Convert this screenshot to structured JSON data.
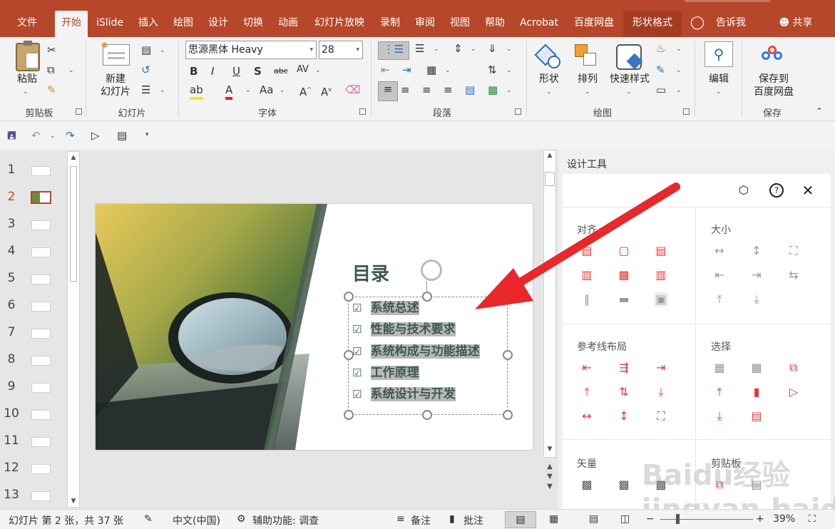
{
  "ribbon_tabs": [
    {
      "label": "文件",
      "active": false
    },
    {
      "label": "开始",
      "active": true
    },
    {
      "label": "iSlide",
      "active": false
    },
    {
      "label": "插入",
      "active": false
    },
    {
      "label": "绘图",
      "active": false
    },
    {
      "label": "设计",
      "active": false
    },
    {
      "label": "切换",
      "active": false
    },
    {
      "label": "动画",
      "active": false
    },
    {
      "label": "幻灯片放映",
      "active": false
    },
    {
      "label": "录制",
      "active": false
    },
    {
      "label": "审阅",
      "active": false
    },
    {
      "label": "视图",
      "active": false
    },
    {
      "label": "帮助",
      "active": false
    },
    {
      "label": "Acrobat",
      "active": false
    },
    {
      "label": "百度网盘",
      "active": false
    },
    {
      "label": "形状格式",
      "active": false
    }
  ],
  "tell_me": "告诉我",
  "share": "共享",
  "ribbon": {
    "paste": "粘贴",
    "clipboard": "剪贴板",
    "new_slide_line1": "新建",
    "new_slide_line2": "幻灯片",
    "slides": "幻灯片",
    "font_name": "思源黑体 Heavy",
    "font_size": "28",
    "font": "字体",
    "paragraph": "段落",
    "shape": "形状",
    "arrange": "排列",
    "quick_styles": "快速样式",
    "drawing": "绘图",
    "edit": "编辑",
    "save_to_line1": "保存到",
    "save_to_line2": "百度网盘",
    "save": "保存"
  },
  "slide_numbers": [
    "1",
    "2",
    "3",
    "4",
    "5",
    "6",
    "7",
    "8",
    "9",
    "10",
    "11",
    "12",
    "13"
  ],
  "selected_slide": "2",
  "slide": {
    "title": "目录",
    "items": [
      "系统总述",
      "性能与技术要求",
      "系统构成与功能描述",
      "工作原理",
      "系统设计与开发"
    ]
  },
  "panel": {
    "title": "设计工具",
    "align": "对齐",
    "size": "大小",
    "guides": "参考线布局",
    "select": "选择",
    "vector": "矢量",
    "clipboard": "剪贴板"
  },
  "status": {
    "slide_info": "幻灯片 第 2 张，共 37 张",
    "language": "中文(中国)",
    "accessibility": "辅助功能: 调查",
    "notes": "备注",
    "comments": "批注",
    "zoom": "39%"
  },
  "watermark": "Baidu经验 jingyan.baidu.com",
  "colors": {
    "accent": "#b7472a",
    "red_arrow": "#e8282b",
    "title_green": "#3d5a4f",
    "tool_red": "#e53838"
  }
}
